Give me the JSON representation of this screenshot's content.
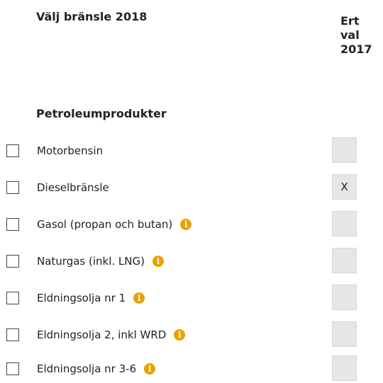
{
  "header": {
    "title": "Välj bränsle 2018",
    "previous_choice_line1": "Ert",
    "previous_choice_line2": "val",
    "previous_choice_line3": "2017"
  },
  "section": {
    "title": "Petroleumprodukter"
  },
  "fuels": [
    {
      "label": "Motorbensin",
      "has_info": false,
      "prev_value": ""
    },
    {
      "label": "Dieselbränsle",
      "has_info": false,
      "prev_value": "X"
    },
    {
      "label": "Gasol (propan och butan)",
      "has_info": true,
      "prev_value": ""
    },
    {
      "label": "Naturgas (inkl. LNG)",
      "has_info": true,
      "prev_value": ""
    },
    {
      "label": "Eldningsolja nr 1",
      "has_info": true,
      "prev_value": ""
    },
    {
      "label": "Eldningsolja 2, inkl WRD",
      "has_info": true,
      "prev_value": ""
    },
    {
      "label": "Eldningsolja nr 3-6",
      "has_info": true,
      "prev_value": ""
    }
  ],
  "icons": {
    "info": "info-icon",
    "info_glyph": "i",
    "info_color": "#e8a100"
  }
}
